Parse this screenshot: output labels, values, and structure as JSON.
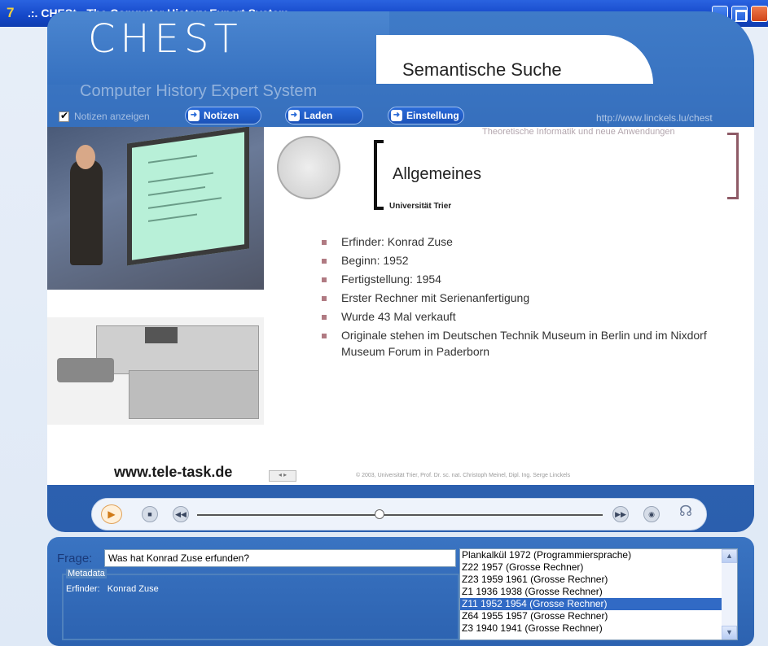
{
  "window": {
    "title": ".:. CHESt - The Computer History Expert System .:.",
    "app_icon": "7"
  },
  "header": {
    "logo_big": "CHEST",
    "logo_small": "Computer History Expert System",
    "section_title": "Semantische Suche"
  },
  "toolbar": {
    "show_notes_label": "Notizen anzeigen",
    "show_notes_checked": true,
    "buttons": [
      "Notizen",
      "Laden",
      "Einstellung"
    ],
    "url": "http://www.linckels.lu/chest"
  },
  "slide": {
    "header_top": "Theoretische Informatik und neue Anwendungen",
    "title": "Allgemeines",
    "university": "Universität Trier",
    "bullets": [
      "Erfinder: Konrad Zuse",
      "Beginn: 1952",
      "Fertigstellung: 1954",
      "Erster Rechner mit Serienanfertigung",
      "Wurde 43 Mal verkauft",
      "Originale stehen im Deutschen Technik Museum in Berlin und im Nixdorf Museum Forum in Paderborn"
    ],
    "copyright": "© 2003, Universität Trier, Prof. Dr. sc. nat. Christoph Meinel, Dipl. Ing. Serge Linckels",
    "teletask": "www.tele-task.de"
  },
  "player": {
    "icons": [
      "play-icon",
      "stop-icon",
      "rewind-icon",
      "fast-forward-icon",
      "volume-icon",
      "help-icon"
    ],
    "position_fraction": 0.45
  },
  "query": {
    "label": "Frage:",
    "value": "Was hat Konrad Zuse erfunden?",
    "metadata_title": "Metadata",
    "metadata_key": "Erfinder:",
    "metadata_value": "Konrad Zuse"
  },
  "results": {
    "items": [
      "Plankalkül 1972 (Programmiersprache)",
      "Z22 1957 (Grosse Rechner)",
      "Z23 1959 1961 (Grosse Rechner)",
      "Z1 1936 1938 (Grosse Rechner)",
      "Z11 1952 1954 (Grosse Rechner)",
      "Z64 1955 1957 (Grosse Rechner)",
      "Z3 1940 1941 (Grosse Rechner)"
    ],
    "selected_index": 4
  }
}
